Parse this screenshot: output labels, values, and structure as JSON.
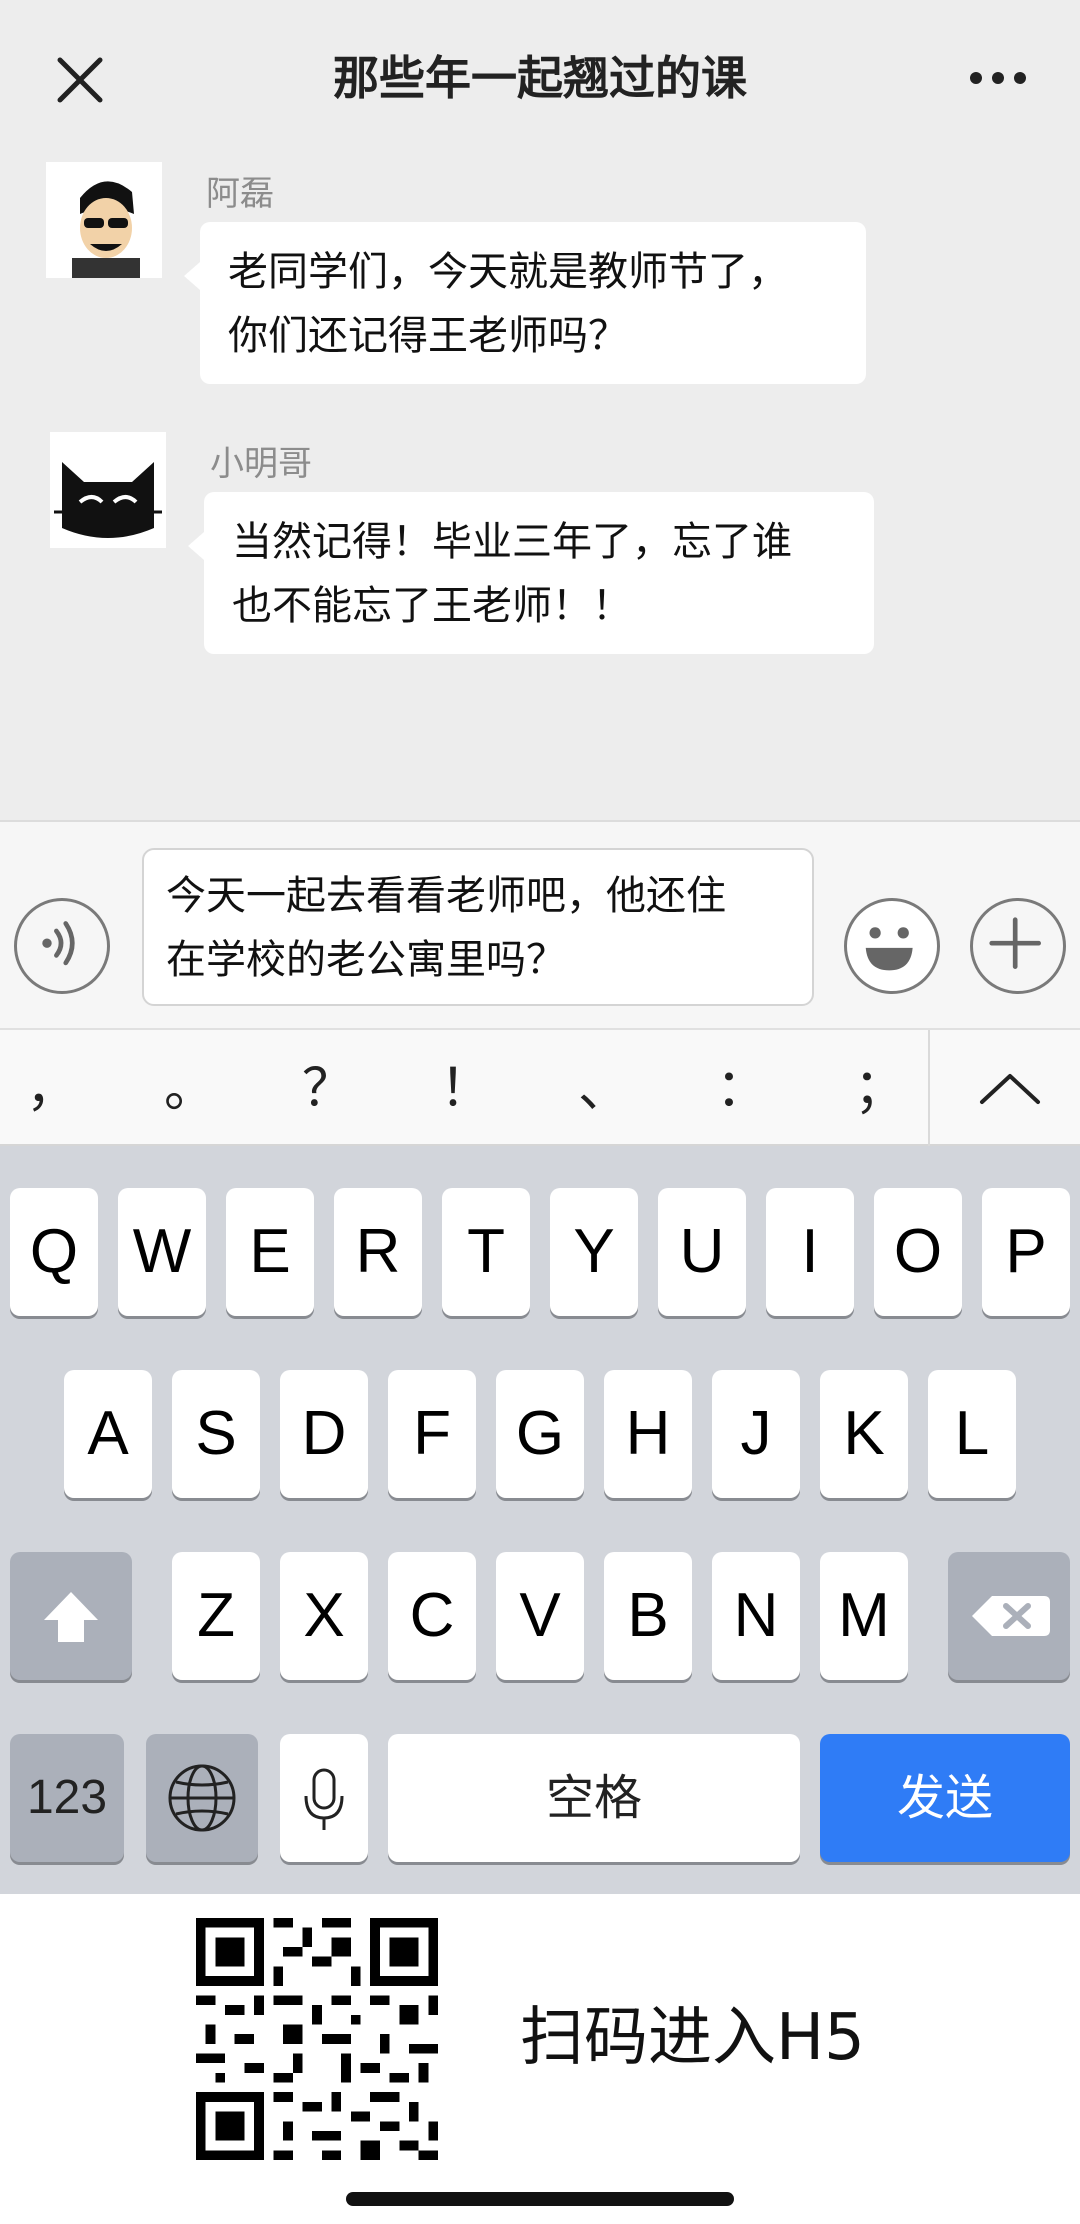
{
  "header": {
    "title": "那些年一起翘过的课",
    "close_icon": "close-icon",
    "more_icon": "more-icon"
  },
  "messages": [
    {
      "sender": "阿磊",
      "avatar": "avatar-cartoon-man",
      "lines": [
        "老同学们，今天就是教师节了，",
        "你们还记得王老师吗？"
      ]
    },
    {
      "sender": "小明哥",
      "avatar": "avatar-black-cat",
      "lines": [
        "当然记得！毕业三年了，忘了谁",
        "也不能忘了王老师！！"
      ]
    }
  ],
  "input": {
    "lines": [
      "今天一起去看看老师吧，他还住",
      "在学校的老公寓里吗？"
    ],
    "voice_icon": "voice-icon",
    "emoji_icon": "emoji-icon",
    "plus_icon": "plus-icon"
  },
  "punctuation": [
    "，",
    "。",
    "？",
    "！",
    "、",
    "：",
    "；"
  ],
  "keyboard": {
    "row1": [
      "Q",
      "W",
      "E",
      "R",
      "T",
      "Y",
      "U",
      "I",
      "O",
      "P"
    ],
    "row2": [
      "A",
      "S",
      "D",
      "F",
      "G",
      "H",
      "J",
      "K",
      "L"
    ],
    "row3": [
      "Z",
      "X",
      "C",
      "V",
      "B",
      "N",
      "M"
    ],
    "numbers_label": "123",
    "space_label": "空格",
    "send_label": "发送",
    "send_color": "#2f7cf6"
  },
  "footer": {
    "qr_text": "扫码进入H5"
  }
}
